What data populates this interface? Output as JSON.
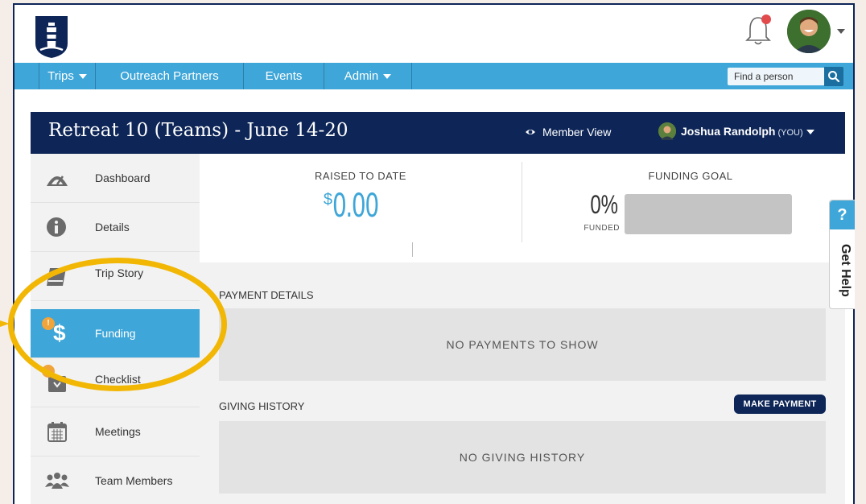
{
  "colors": {
    "navy": "#0d2557",
    "accent": "#3ea6d8",
    "badge": "#f0a43a",
    "highlight": "#f2b705"
  },
  "header": {
    "logo_icon": "lighthouse-logo-icon",
    "bell_icon": "bell-notification-icon",
    "avatar_icon": "user-avatar"
  },
  "nav": {
    "items": [
      {
        "label": "Trips",
        "has_caret": true
      },
      {
        "label": "Outreach Partners",
        "has_caret": false
      },
      {
        "label": "Events",
        "has_caret": false
      },
      {
        "label": "Admin",
        "has_caret": true
      }
    ],
    "search": {
      "placeholder": "Find a person",
      "icon": "search-icon"
    }
  },
  "trip": {
    "title": "Retreat 10 (Teams) - June 14-20",
    "member_view_label": "Member View",
    "user_name": "Joshua Randolph",
    "you_tag": "(YOU)"
  },
  "sidebar": {
    "items": [
      {
        "label": "Dashboard",
        "icon": "gauge-icon"
      },
      {
        "label": "Details",
        "icon": "info-icon"
      },
      {
        "label": "Trip Story",
        "icon": "book-icon"
      },
      {
        "label": "Funding",
        "icon": "dollar-icon",
        "active": true,
        "badge": "!"
      },
      {
        "label": "Checklist",
        "icon": "checklist-icon"
      },
      {
        "label": "Meetings",
        "icon": "calendar-icon"
      },
      {
        "label": "Team Members",
        "icon": "team-icon"
      }
    ]
  },
  "funding": {
    "raised_label": "RAISED TO DATE",
    "raised_currency": "$",
    "raised_value": "0.00",
    "goal_label": "FUNDING GOAL",
    "percent": "0%",
    "percent_fraction": 0,
    "funded_label": "FUNDED"
  },
  "payments": {
    "title": "PAYMENT DETAILS",
    "empty": "NO PAYMENTS TO SHOW"
  },
  "giving": {
    "title": "GIVING HISTORY",
    "make_payment": "MAKE PAYMENT",
    "empty": "NO GIVING HISTORY"
  },
  "help": {
    "q": "?",
    "label": "Get Help"
  }
}
